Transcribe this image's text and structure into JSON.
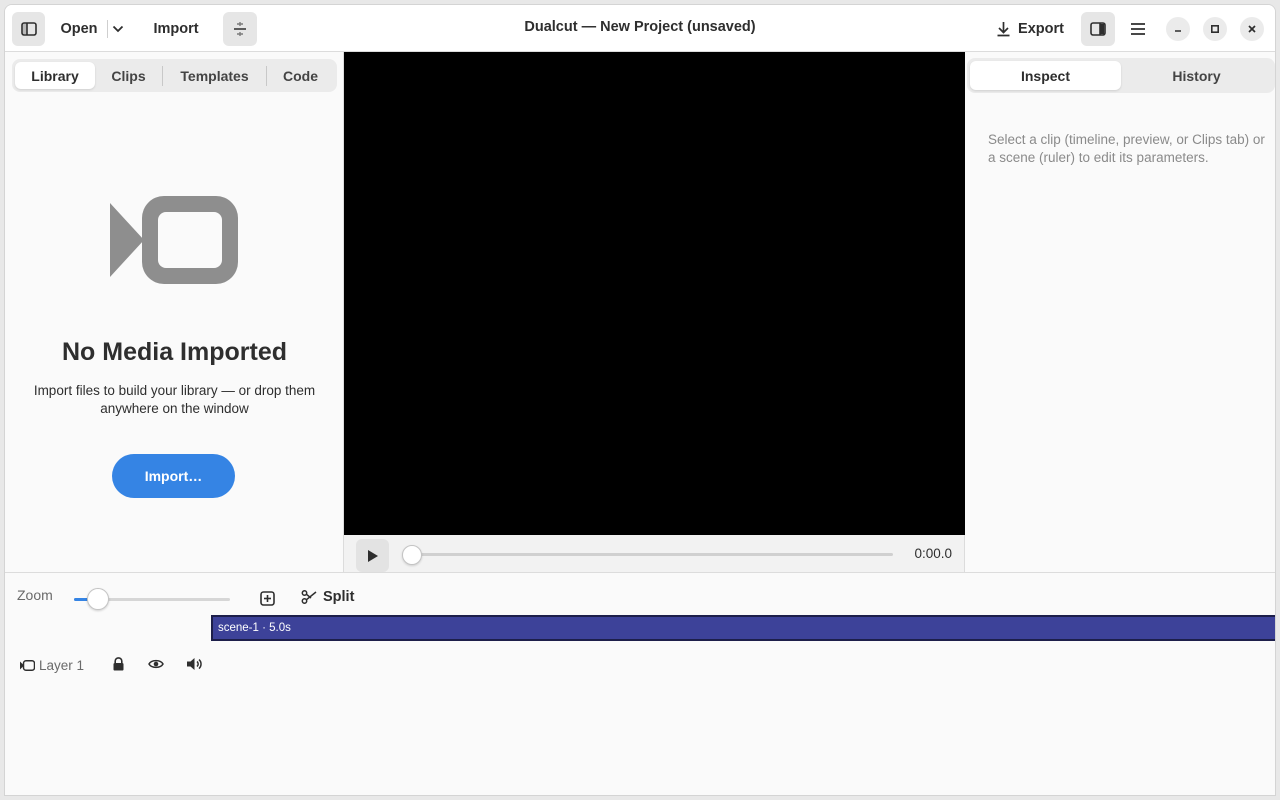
{
  "header": {
    "title": "Dualcut — New Project (unsaved)",
    "open_label": "Open",
    "import_label": "Import",
    "export_label": "Export"
  },
  "left_tabs": [
    "Library",
    "Clips",
    "Templates",
    "Code"
  ],
  "library": {
    "empty_title": "No Media Imported",
    "empty_desc": "Import files to build your library — or drop them anywhere on the window",
    "import_button": "Import…"
  },
  "player": {
    "time": "0:00.0",
    "progress": 0
  },
  "right_tabs": [
    "Inspect",
    "History"
  ],
  "inspector": {
    "hint": "Select a clip (timeline, preview, or Clips tab) or a scene (ruler) to edit its parameters."
  },
  "timeline": {
    "zoom_label": "Zoom",
    "split_label": "Split",
    "scene_label": "scene-1 · 5.0s",
    "layer_name": "Layer 1"
  },
  "colors": {
    "accent": "#3584e4",
    "scene_bar": "#3d4299"
  }
}
